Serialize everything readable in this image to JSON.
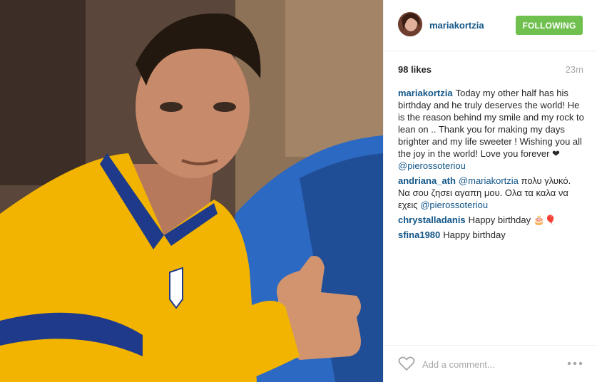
{
  "post": {
    "username": "mariakortzia",
    "follow_label": "FOLLOWING",
    "likes": "98 likes",
    "time": "23m"
  },
  "comments": [
    {
      "user": "mariakortzia",
      "text": "Today my other half has his birthday and he truly deserves the world! He is the reason behind my smile and my rock to lean on .. Thank you for making my days brighter and my life sweeter ! Wishing you all the joy in the world! Love you forever ❤",
      "mention": "@pierossoteriou"
    },
    {
      "user": "andriana_ath",
      "mention_pre": "@mariakortzia",
      "text": "πολυ γλυκό. Να σου ζησει αγαπη μου. Ολα τα καλα να εχεις",
      "mention": "@pierossoteriou"
    },
    {
      "user": "chrystalladanis",
      "text": "Happy birthday 🎂🎈"
    },
    {
      "user": "sfina1980",
      "text": "Happy birthday"
    }
  ],
  "footer": {
    "comment_placeholder": "Add a comment..."
  },
  "colors": {
    "username": "#125688",
    "follow_button": "#70c050",
    "muted": "#a5a7aa"
  },
  "icons": {
    "like": "heart-outline-icon",
    "more": "ellipsis-icon"
  }
}
